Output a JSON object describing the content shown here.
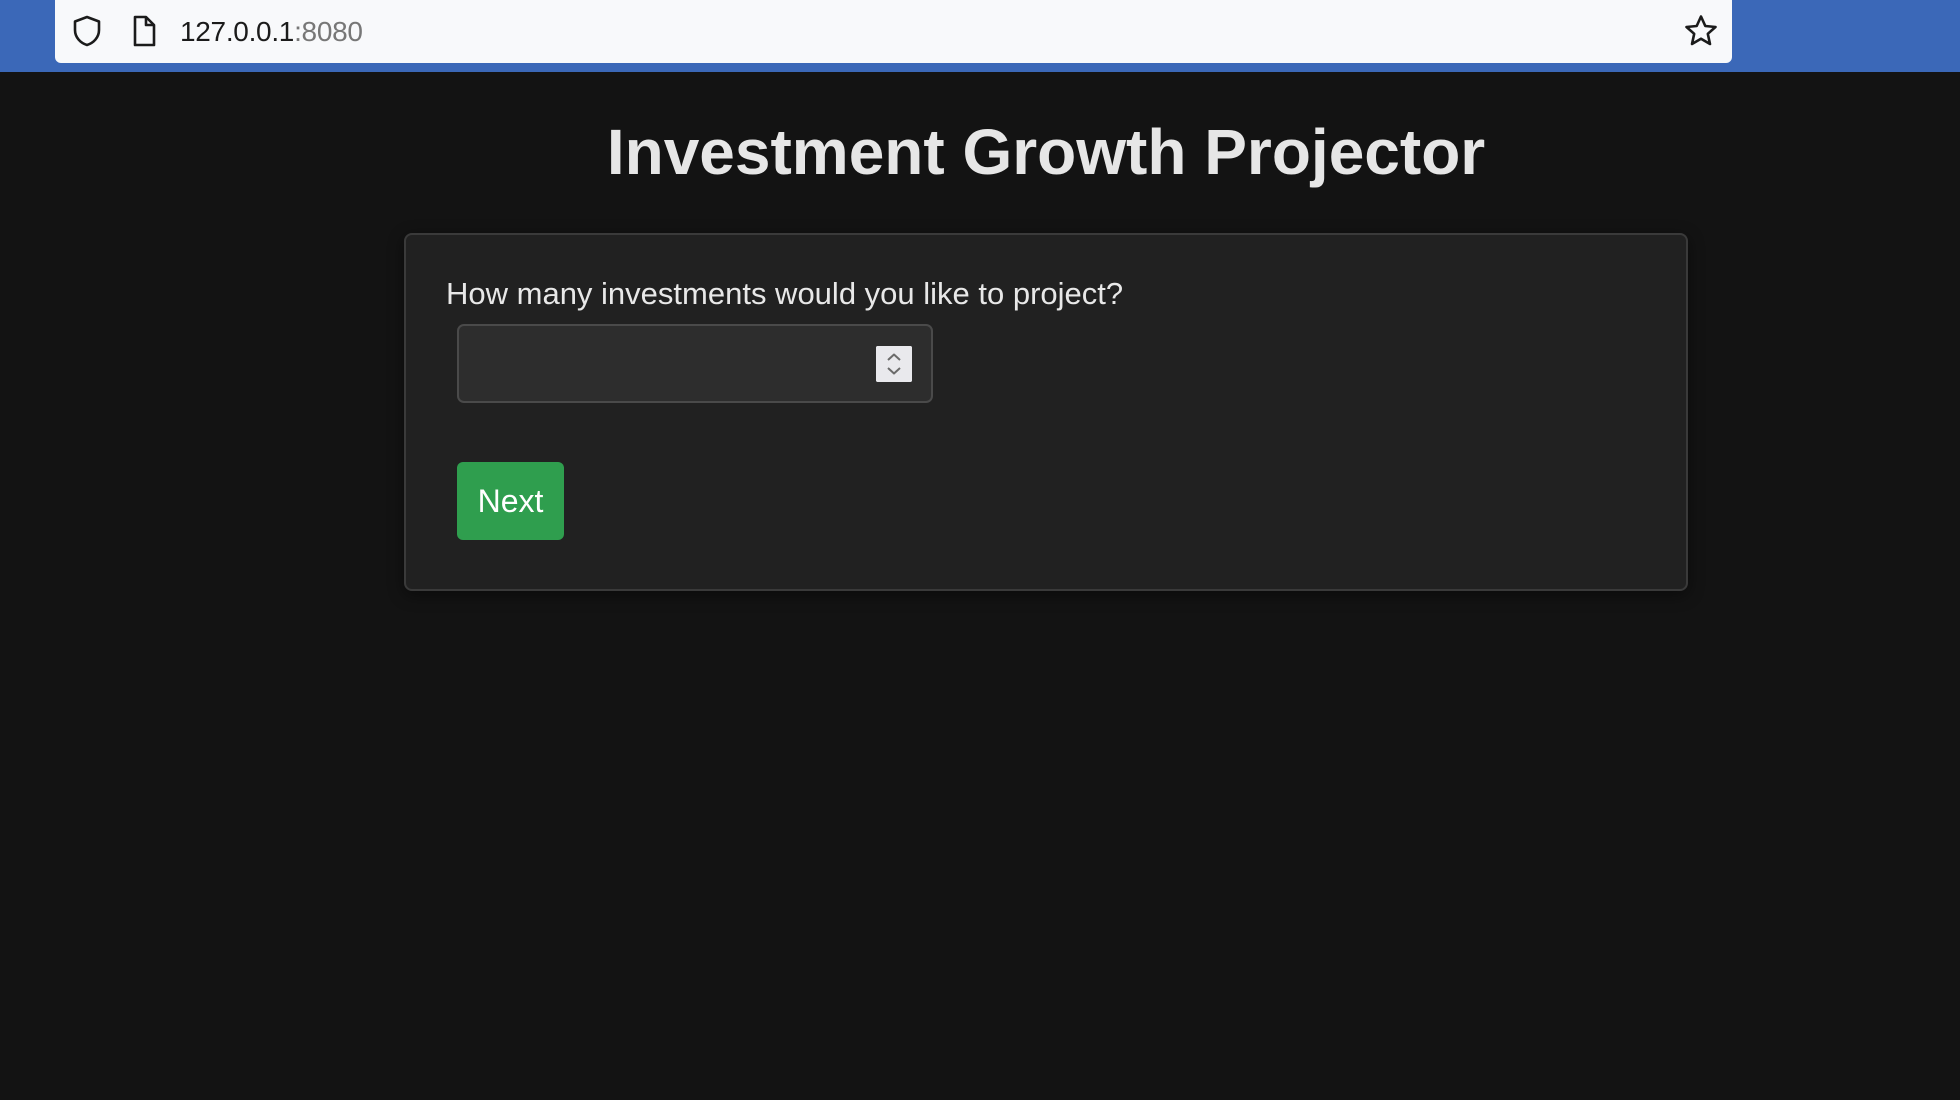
{
  "browser": {
    "url_host": "127.0.0.1",
    "url_port": ":8080"
  },
  "page": {
    "title": "Investment Growth Projector",
    "question": "How many investments would you like to project?",
    "input_value": "",
    "next_label": "Next"
  },
  "colors": {
    "browser_accent": "#3b68b8",
    "background": "#131313",
    "card": "#212121",
    "next_button": "#2f9e4e"
  },
  "icons": {
    "shield": "shield-icon",
    "page": "page-icon",
    "bookmark": "star-icon",
    "stepper": "spin-stepper-icon"
  }
}
